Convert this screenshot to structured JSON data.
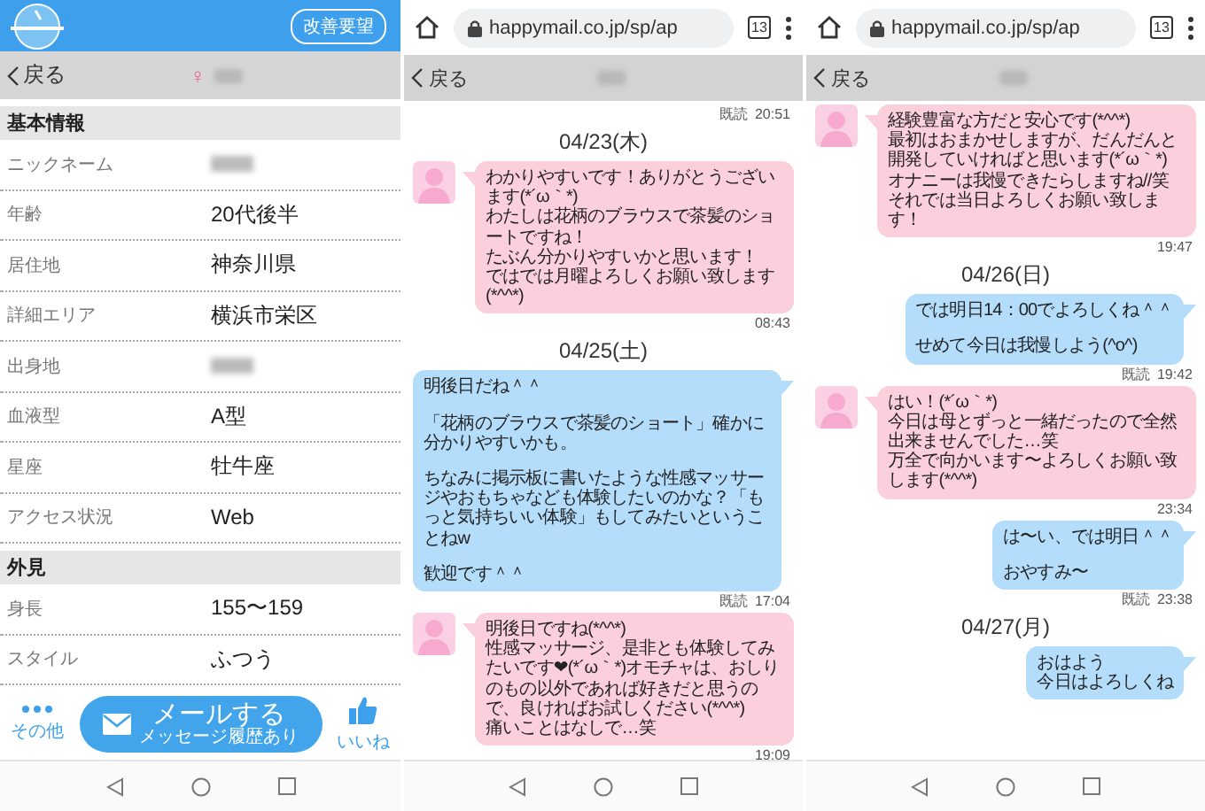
{
  "profile": {
    "feedback_button": "改善要望",
    "back": "戻る",
    "gender_symbol": "♀",
    "sections": [
      {
        "title": "基本情報",
        "rows": [
          {
            "label": "ニックネーム",
            "blurred": true
          },
          {
            "label": "年齢",
            "value": "20代後半",
            "blurred": false
          },
          {
            "label": "居住地",
            "value": "神奈川県",
            "blurred": false
          },
          {
            "label": "詳細エリア",
            "value": "横浜市栄区",
            "blurred": false
          },
          {
            "label": "出身地",
            "blurred": true
          },
          {
            "label": "血液型",
            "value": "A型",
            "blurred": false
          },
          {
            "label": "星座",
            "value": "牡牛座",
            "blurred": false
          },
          {
            "label": "アクセス状況",
            "value": "Web",
            "blurred": false
          }
        ]
      },
      {
        "title": "外見",
        "rows": [
          {
            "label": "身長",
            "value": "155〜159",
            "blurred": false
          },
          {
            "label": "スタイル",
            "value": "ふつう",
            "blurred": false
          }
        ]
      }
    ],
    "action_bar": {
      "more_label": "その他",
      "mail_button": "メールする",
      "mail_sub": "メッセージ履歴あり",
      "like_label": "いいね"
    }
  },
  "chats": [
    {
      "url": "happymail.co.jp/sp/ap",
      "tab_count": "13",
      "back": "戻る",
      "messages": [
        {
          "kind": "status",
          "read": "既読",
          "time": "20:51"
        },
        {
          "kind": "date",
          "text": "04/23(木)"
        },
        {
          "kind": "received",
          "paragraphs": [
            [
              "わかりやすいです！ありがとうございます(*´ω｀*)",
              "わたしは花柄のブラウスで茶髪のショートですね！",
              "たぶん分かりやすいかと思います！",
              "ではでは月曜よろしくお願い致します(*^^*)"
            ]
          ],
          "time": "08:43"
        },
        {
          "kind": "date",
          "text": "04/25(土)"
        },
        {
          "kind": "sent",
          "paragraphs": [
            [
              "明後日だね＾＾"
            ],
            [
              "「花柄のブラウスで茶髪のショート」確かに分かりやすいかも。"
            ],
            [
              "ちなみに掲示板に書いたような性感マッサージやおもちゃなども体験したいのかな？「もっと気持ちいい体験」もしてみたいということねw"
            ],
            [
              "歓迎です＾＾"
            ]
          ],
          "read": "既読",
          "time": "17:04"
        },
        {
          "kind": "received",
          "paragraphs": [
            [
              "明後日ですね(*^^*)",
              "性感マッサージ、是非とも体験してみたいです❤(*´ω｀*)オモチャは、おしりのもの以外であれば好きだと思うので、良ければお試しください(*^^*)",
              "痛いことはなしで…笑"
            ]
          ],
          "time": "19:09"
        }
      ]
    },
    {
      "url": "happymail.co.jp/sp/ap",
      "tab_count": "13",
      "back": "戻る",
      "messages": [
        {
          "kind": "received",
          "paragraphs": [
            [
              "経験豊富な方だと安心です(*^^*)",
              "最初はおまかせしますが、だんだんと開発していければと思います(*´ω｀*)",
              "オナニーは我慢できたらしますね//笑",
              "それでは当日よろしくお願い致します！"
            ]
          ],
          "time": "19:47"
        },
        {
          "kind": "date",
          "text": "04/26(日)"
        },
        {
          "kind": "sent",
          "paragraphs": [
            [
              "では明日14：00でよろしくね＾＾"
            ],
            [
              "せめて今日は我慢しよう(^o^)"
            ]
          ],
          "read": "既読",
          "time": "19:42"
        },
        {
          "kind": "received",
          "paragraphs": [
            [
              "はい！(*´ω｀*)",
              "今日は母とずっと一緒だったので全然出来ませんでした…笑",
              "万全で向かいます〜よろしくお願い致します(*^^*)"
            ]
          ],
          "time": "23:34"
        },
        {
          "kind": "sent",
          "paragraphs": [
            [
              "は〜い、では明日＾＾"
            ],
            [
              "おやすみ〜"
            ]
          ],
          "read": "既読",
          "time": "23:38"
        },
        {
          "kind": "date",
          "text": "04/27(月)"
        },
        {
          "kind": "sent",
          "paragraphs": [
            [
              "おはよう",
              "今日はよろしくね"
            ]
          ]
        }
      ]
    }
  ]
}
